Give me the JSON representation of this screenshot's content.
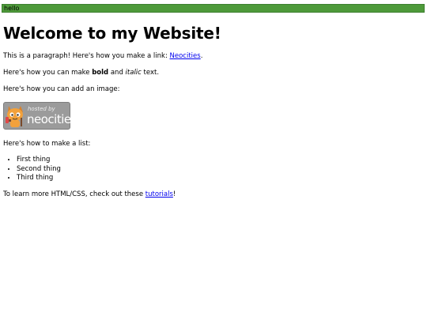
{
  "top_bar": {
    "text": "hello",
    "color": "#4e9a3a"
  },
  "heading": "Welcome to my Website!",
  "paragraph1": {
    "before": "This is a paragraph! Here's how you make a link: ",
    "link": "Neocities",
    "after": "."
  },
  "paragraph2": {
    "before": "Here's how you can make ",
    "bold": "bold",
    "middle": " and ",
    "italic": "italic",
    "after": " text."
  },
  "paragraph3": "Here's how you can add an image:",
  "image_badge": {
    "hosted": "hosted by",
    "brand": "neocities",
    "icon": "neocities-cat-icon"
  },
  "paragraph4": "Here's how to make a list:",
  "list": [
    "First thing",
    "Second thing",
    "Third thing"
  ],
  "paragraph5": {
    "before": "To learn more HTML/CSS, check out these ",
    "link": "tutorials",
    "after": "!"
  },
  "link_color": "#0000ee"
}
